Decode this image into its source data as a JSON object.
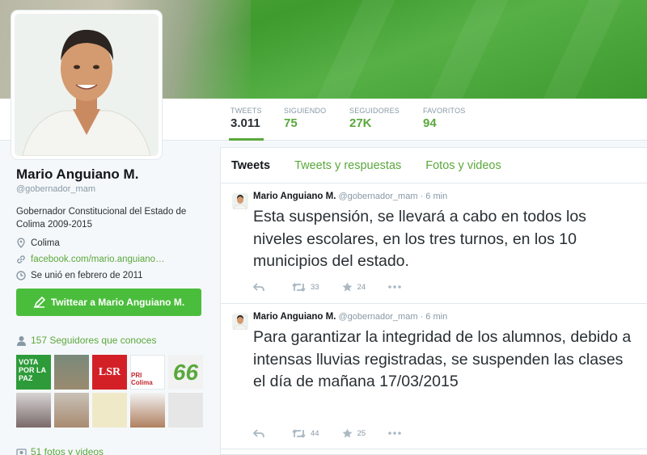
{
  "profile": {
    "name": "Mario Anguiano M.",
    "handle": "@gobernador_mam",
    "bio": "Gobernador Constitucional del Estado de Colima 2009-2015",
    "location": "Colima",
    "website": "facebook.com/mario.anguiano…",
    "joined": "Se unió en febrero de 2011",
    "tweet_to_button": "Twittear a Mario Anguiano M.",
    "followers_you_know": "157 Seguidores que conoces",
    "photos_videos": "51 fotos y videos"
  },
  "stats": [
    {
      "label": "TWEETS",
      "value": "3.011"
    },
    {
      "label": "SIGUIENDO",
      "value": "75"
    },
    {
      "label": "SEGUIDORES",
      "value": "27K"
    },
    {
      "label": "FAVORITOS",
      "value": "94"
    }
  ],
  "tabs": [
    "Tweets",
    "Tweets y respuestas",
    "Fotos y videos"
  ],
  "follower_tiles": [
    {
      "label": "VOTA POR LA PAZ"
    },
    {
      "label": ""
    },
    {
      "label": "LSR"
    },
    {
      "label": "PRI Colima"
    },
    {
      "label": "66"
    },
    {
      "label": ""
    },
    {
      "label": ""
    },
    {
      "label": ""
    },
    {
      "label": ""
    },
    {
      "label": ""
    }
  ],
  "tweets": [
    {
      "name": "Mario Anguiano M.",
      "handle": "@gobernador_mam",
      "time": "· 6 min",
      "text": "Esta suspensión, se llevará a cabo en todos los niveles escolares, en los tres turnos, en los 10 municipios del estado.",
      "retweets": "33",
      "favorites": "24"
    },
    {
      "name": "Mario Anguiano M.",
      "handle": "@gobernador_mam",
      "time": "· 6 min",
      "text": "Para garantizar la integridad de los alumnos, debido a intensas lluvias registradas,  se suspenden las clases el día de mañana 17/03/2015",
      "retweets": "44",
      "favorites": "25"
    }
  ],
  "colors": {
    "accent": "#5aa83c",
    "button": "#4bbd3c"
  },
  "icons": [
    "location-icon",
    "link-icon",
    "calendar-icon",
    "compose-icon",
    "person-icon",
    "camera-icon",
    "reply-icon",
    "retweet-icon",
    "star-icon",
    "more-icon"
  ]
}
